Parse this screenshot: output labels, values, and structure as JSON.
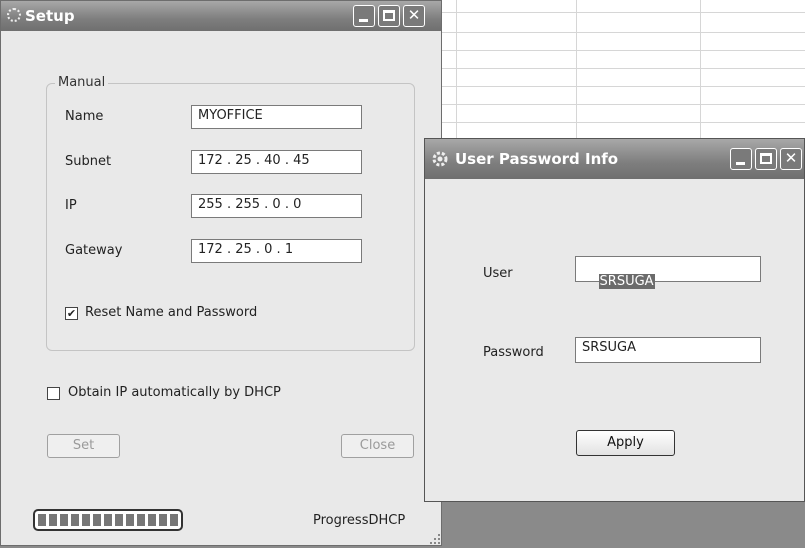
{
  "setup": {
    "title": "Setup",
    "group_label": "Manual",
    "name_label": "Name",
    "name_value": "MYOFFICE",
    "subnet_label": "Subnet",
    "subnet_value": "172 . 25 . 40 . 45",
    "ip_label": "IP",
    "ip_value": "255 . 255 . 0 . 0",
    "gateway_label": "Gateway",
    "gateway_value": "172 . 25 . 0 . 1",
    "reset_label": "Reset Name and Password",
    "reset_checked": true,
    "dhcp_label": "Obtain IP automatically by DHCP",
    "dhcp_checked": false,
    "set_label": "Set",
    "close_label": "Close",
    "progress_label": "ProgressDHCP"
  },
  "password_dialog": {
    "title": "User Password Info",
    "user_label": "User",
    "user_value": "SRSUGA",
    "password_label": "Password",
    "password_value": "SRSUGA",
    "apply_label": "Apply"
  },
  "check_mark": "✔"
}
